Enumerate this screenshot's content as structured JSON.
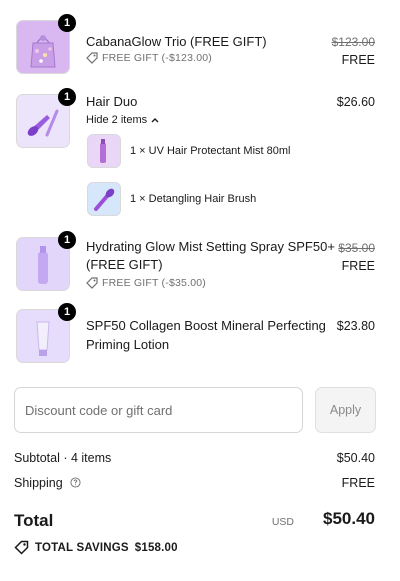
{
  "items": [
    {
      "name": "CabanaGlow Trio (FREE GIFT)",
      "quantity": "1",
      "original_price": "$123.00",
      "price": "FREE",
      "discount": "FREE GIFT (-$123.00)",
      "icon": "gift-bag-image"
    },
    {
      "name": "Hair Duo",
      "quantity": "1",
      "price": "$26.60",
      "toggle_label": "Hide 2 items",
      "icon": "hair-duo-image",
      "components": [
        {
          "label": "1 × UV Hair Protectant Mist 80ml",
          "icon": "mist-bottle-image"
        },
        {
          "label": "1 × Detangling Hair Brush",
          "icon": "hair-brush-image"
        }
      ]
    },
    {
      "name_line1": "Hydrating Glow Mist Setting Spray SPF50+",
      "name_line2": "(FREE GIFT)",
      "quantity": "1",
      "original_price": "$35.00",
      "price": "FREE",
      "discount": "FREE GIFT (-$35.00)",
      "icon": "spray-bottle-image"
    },
    {
      "name_line1": "SPF50 Collagen Boost Mineral Perfecting",
      "name_line2": "Priming Lotion",
      "quantity": "1",
      "price": "$23.80",
      "icon": "lotion-tube-image"
    }
  ],
  "discount": {
    "placeholder": "Discount code or gift card",
    "value": "",
    "apply_label": "Apply"
  },
  "summary": {
    "subtotal_label": "Subtotal · 4 items",
    "subtotal_value": "$50.40",
    "shipping_label": "Shipping",
    "shipping_value": "FREE",
    "total_label": "Total",
    "currency": "USD",
    "total_value": "$50.40",
    "savings_label": "TOTAL SAVINGS",
    "savings_value": "$158.00"
  },
  "colors": {
    "thumb_bg": "#eadcf8",
    "badge_bg": "#000000",
    "muted_text": "#707070"
  }
}
